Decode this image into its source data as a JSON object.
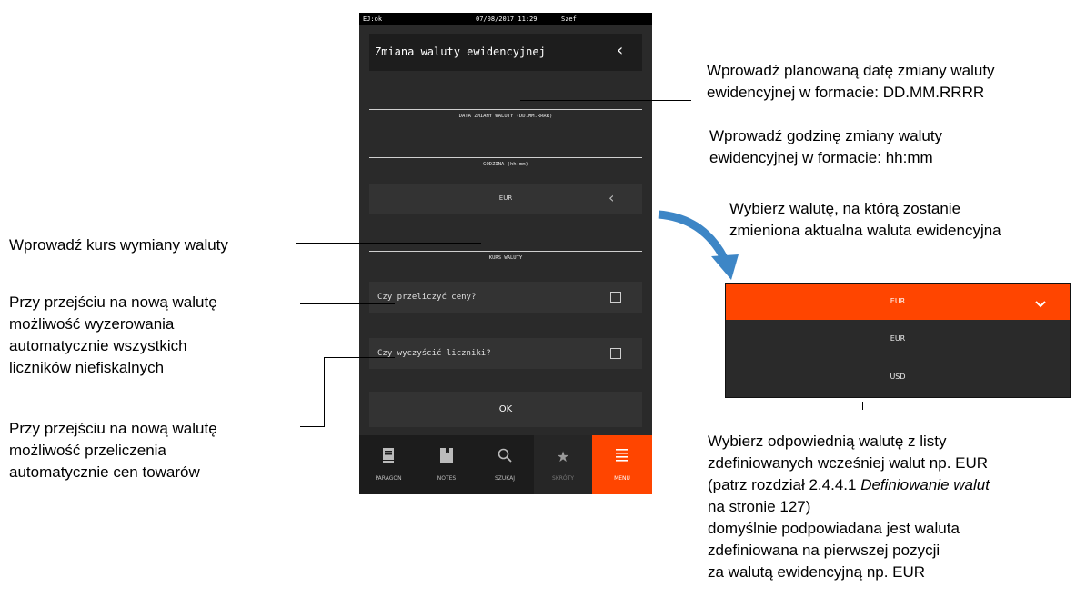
{
  "device": {
    "status": {
      "left": "EJ:ok",
      "datetime": "07/08/2017  11:29",
      "user": "Szef"
    },
    "header": {
      "title": "Zmiana waluty ewidencyjnej",
      "back_icon": "chevron-left-icon"
    },
    "fields": {
      "date_label": "DATA ZMIANY WALUTY (DD.MM.RRRR)",
      "time_label": "GODZINA (hh:mm)",
      "currency_value": "EUR",
      "rate_label": "KURS WALUTY"
    },
    "checkboxes": {
      "recalc_label": "Czy przeliczyć ceny?",
      "recalc_checked": false,
      "clear_label": "Czy wyczyścić liczniki?",
      "clear_checked": false
    },
    "ok_label": "OK",
    "nav": [
      {
        "label": "PARAGON",
        "icon": "receipt-icon"
      },
      {
        "label": "NOTES",
        "icon": "notes-icon"
      },
      {
        "label": "SZUKAJ",
        "icon": "search-icon"
      },
      {
        "label": "SKRÓTY",
        "icon": "star-icon"
      },
      {
        "label": "MENU",
        "icon": "menu-icon"
      }
    ]
  },
  "dropdown": {
    "selected": "EUR",
    "options": [
      "EUR",
      "USD"
    ]
  },
  "annotations": {
    "date": [
      "Wprowadź planowaną datę zmiany waluty",
      "ewidencyjnej w formacie: DD.MM.RRRR"
    ],
    "time": [
      "Wprowadź godzinę zmiany waluty",
      "ewidencyjnej w formacie: hh:mm"
    ],
    "currency": [
      "Wybierz walutę, na którą zostanie",
      "zmieniona aktualna waluta ewidencyjna"
    ],
    "rate": "Wprowadź kurs wymiany waluty",
    "clear": [
      "Przy przejściu na nową walutę",
      "możliwość wyzerowania",
      "automatycznie wszystkich",
      "liczników niefiskalnych"
    ],
    "recalc": [
      "Przy przejściu na nową walutę",
      "możliwość przeliczenia",
      "automatycznie cen towarów"
    ],
    "list": {
      "line1": "Wybierz odpowiednią walutę z listy",
      "line2": "zdefiniowanych wcześniej walut np. EUR",
      "line3_pre": "(patrz rozdział 2.4.4.1 ",
      "line3_italic": "Definiowanie walut",
      "line4": "na stronie 127)",
      "line5": "domyślnie podpowiadana jest waluta",
      "line6": "zdefiniowana na pierwszej pozycji",
      "line7": "za walutą ewidencyjną np. EUR"
    }
  }
}
